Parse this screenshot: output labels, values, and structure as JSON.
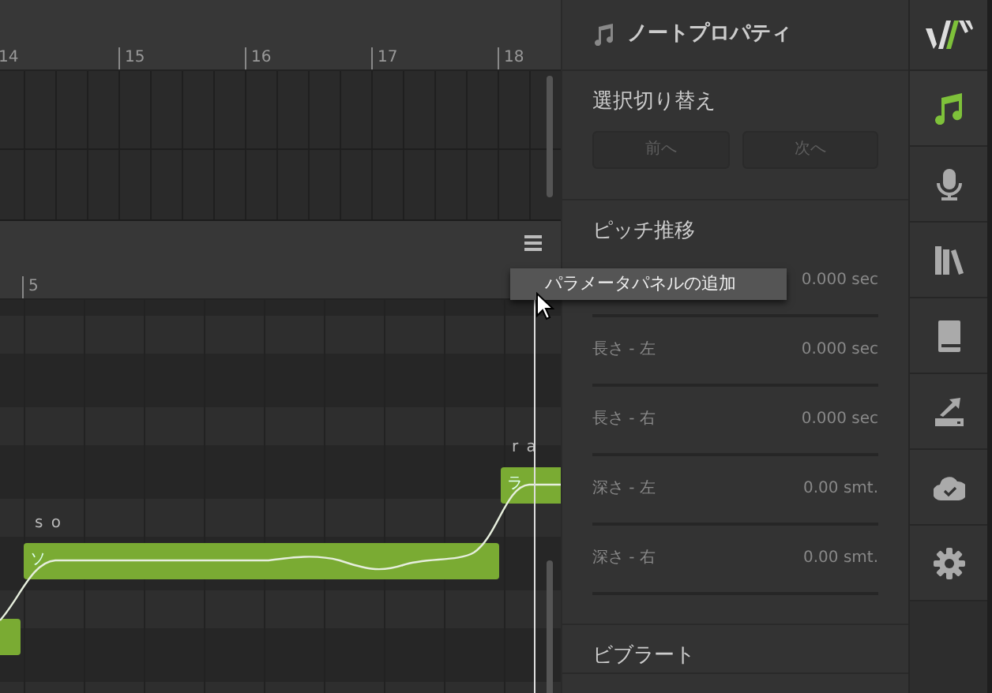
{
  "timeline_top": {
    "bar_labels": [
      "14",
      "15",
      "16",
      "17",
      "18"
    ]
  },
  "piano_roll": {
    "bar_labels": [
      "5"
    ],
    "notes": [
      {
        "kind": "plain"
      },
      {
        "kind": "sung",
        "lyric": "ソ",
        "phoneme": "s o"
      },
      {
        "kind": "sung",
        "lyric": "ラ",
        "phoneme": "r a"
      }
    ]
  },
  "context_menu": {
    "items": [
      {
        "label": "パラメータパネルの追加"
      }
    ]
  },
  "note_properties": {
    "title": "ノートプロパティ",
    "selection_switch": {
      "label": "選択切り替え",
      "buttons": [
        {
          "label": "前へ",
          "disabled": true
        },
        {
          "label": "次へ",
          "disabled": true
        }
      ]
    },
    "pitch_transition": {
      "label": "ピッチ推移",
      "params": [
        {
          "value": "0.000 sec"
        },
        {
          "label": "長さ - 左",
          "value": "0.000 sec"
        },
        {
          "label": "長さ - 右",
          "value": "0.000 sec"
        },
        {
          "label": "深さ - 左",
          "value": "0.00 smt."
        },
        {
          "label": "深さ - 右",
          "value": "0.00 smt."
        }
      ]
    },
    "vibrato": {
      "label": "ビブラート"
    }
  },
  "sidebar": {
    "items": [
      {
        "kind": "note",
        "selected": true
      },
      {
        "kind": "mic",
        "selected": false
      },
      {
        "kind": "library",
        "selected": false
      },
      {
        "kind": "book",
        "selected": false
      },
      {
        "kind": "export",
        "selected": false
      },
      {
        "kind": "cloud",
        "selected": false
      },
      {
        "kind": "settings",
        "selected": false
      }
    ]
  }
}
